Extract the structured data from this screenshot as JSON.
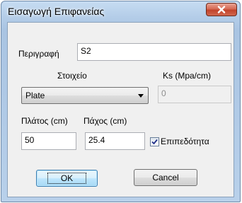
{
  "window": {
    "title": "Εισαγωγή Επιφανείας",
    "close_symbol": "×"
  },
  "form": {
    "description_label": "Περιγραφή",
    "description_value": "S2",
    "element_label": "Στοιχείο",
    "element_selected": "Plate",
    "ks_label": "Ks (Mpa/cm)",
    "ks_value": "0",
    "width_label": "Πλάτος (cm)",
    "width_value": "50",
    "thickness_label": "Πάχος (cm)",
    "thickness_value": "25.4",
    "planar_label": "Επιπεδότητα",
    "planar_checked": true
  },
  "buttons": {
    "ok": "OK",
    "cancel": "Cancel"
  }
}
